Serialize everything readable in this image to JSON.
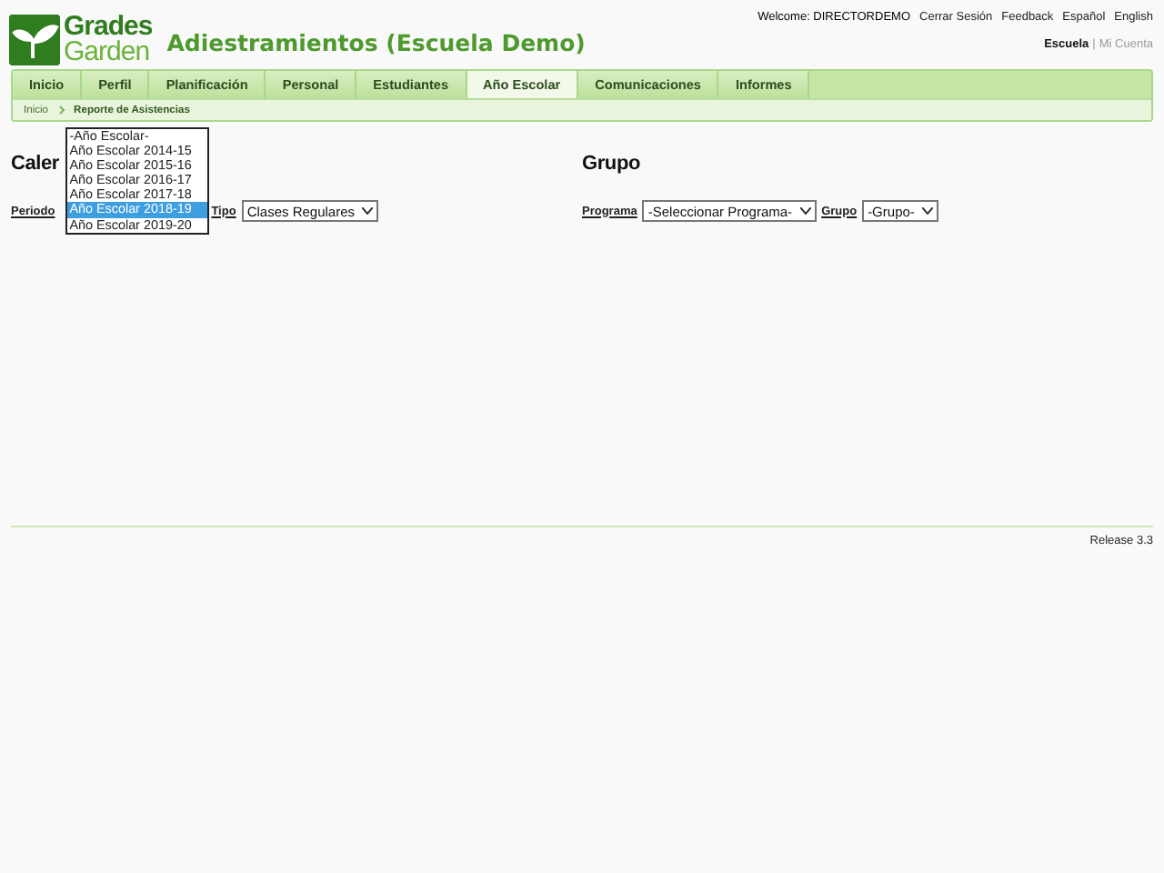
{
  "header": {
    "logo_line1": "Grades",
    "logo_line2": "Garden",
    "title": "Adiestramientos (Escuela Demo)",
    "top_links": [
      "Welcome: DIRECTORDEMO",
      "Cerrar Sesión",
      "Feedback",
      "Español",
      "English"
    ],
    "account_separator": "|",
    "account_links": [
      {
        "label": "Escuela",
        "selected": true
      },
      {
        "label": "Mi Cuenta",
        "selected": false
      }
    ]
  },
  "nav": [
    {
      "label": "Inicio",
      "selected": false
    },
    {
      "label": "Perfil",
      "selected": false
    },
    {
      "label": "Planificación",
      "selected": false
    },
    {
      "label": "Personal",
      "selected": false
    },
    {
      "label": "Estudiantes",
      "selected": false
    },
    {
      "label": "Año Escolar",
      "selected": true
    },
    {
      "label": "Comunicaciones",
      "selected": false
    },
    {
      "label": "Informes",
      "selected": false
    }
  ],
  "breadcrumb": [
    "Inicio",
    "Reporte de Asistencias"
  ],
  "left": {
    "heading": "Caler",
    "periodo_label": "Periodo",
    "periodo_options": [
      {
        "label": "-Año Escolar-",
        "selected": false
      },
      {
        "label": "Año Escolar 2014-15",
        "selected": false
      },
      {
        "label": "Año Escolar 2015-16",
        "selected": false
      },
      {
        "label": "Año Escolar 2016-17",
        "selected": false
      },
      {
        "label": "Año Escolar 2017-18",
        "selected": false
      },
      {
        "label": "Año Escolar 2018-19",
        "selected": true
      },
      {
        "label": "Año Escolar 2019-20",
        "selected": false
      }
    ],
    "tipo_label": "Tipo",
    "tipo_value": "Clases Regulares"
  },
  "right": {
    "heading": "Grupo",
    "programa_label": "Programa",
    "programa_value": "-Seleccionar Programa-",
    "grupo_label": "Grupo",
    "grupo_value": "-Grupo-"
  },
  "footer": {
    "release": "Release 3.3"
  }
}
